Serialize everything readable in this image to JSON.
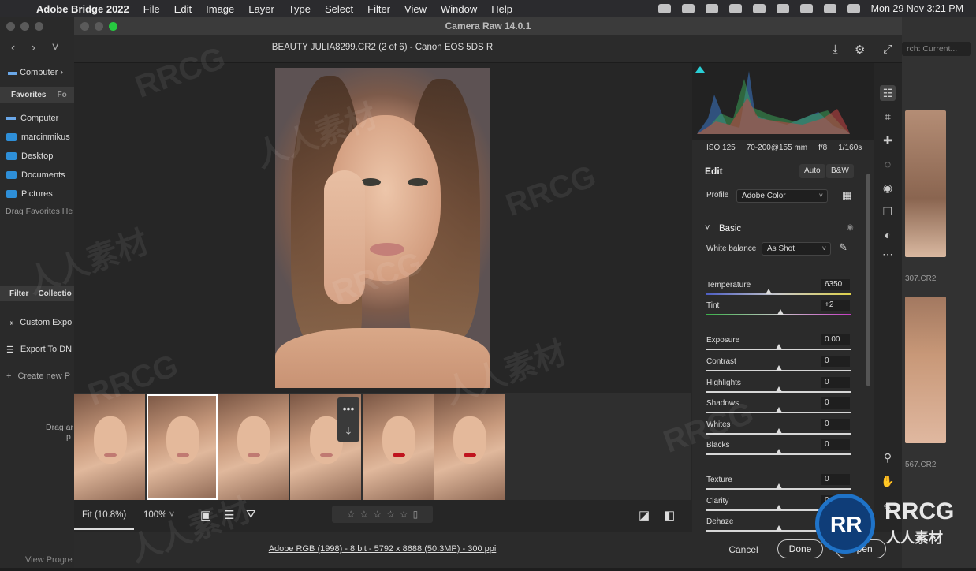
{
  "menubar": {
    "app_name": "Adobe Bridge 2022",
    "items": [
      "File",
      "Edit",
      "Image",
      "Layer",
      "Type",
      "Select",
      "Filter",
      "View",
      "Window",
      "Help"
    ],
    "clock": "Mon 29 Nov  3:21 PM"
  },
  "bridge": {
    "path_label": "Computer",
    "tab_favorites": "Favorites",
    "tab_folders": "Fo",
    "favorites": [
      "Computer",
      "marcinmikus",
      "Desktop",
      "Documents",
      "Pictures"
    ],
    "drag_hint": "Drag Favorites He",
    "filter_tab": "Filter",
    "collections_tab": "Collectio",
    "collections": [
      "Custom Expo",
      "Export To DN",
      "Create new P"
    ],
    "drag_hint2": "Drag ar",
    "drag_hint2b": "p",
    "view_progress": "View Progre",
    "search_placeholder": "rch: Current...",
    "thumb_captions": [
      "307.CR2",
      "567.CR2"
    ]
  },
  "camera_raw": {
    "window_title": "Camera Raw 14.0.1",
    "filename": "BEAUTY JULIA8299.CR2 (2 of 6)  -  Canon EOS 5DS R",
    "zoom_fit": "Fit (10.8%)",
    "zoom_level": "100%",
    "workflow": "Adobe RGB (1998) - 8 bit - 5792 x 8688 (50.3MP) - 300 ppi",
    "cancel": "Cancel",
    "done": "Done",
    "open": "Open",
    "thumb_menu": "•••",
    "filmstrip_lips": [
      "natural",
      "natural",
      "natural",
      "natural",
      "red",
      "red"
    ],
    "selected_index": 1
  },
  "panel": {
    "exif": [
      "ISO 125",
      "70-200@155 mm",
      "f/8",
      "1/160s"
    ],
    "edit_title": "Edit",
    "auto": "Auto",
    "bw": "B&W",
    "profile_label": "Profile",
    "profile_value": "Adobe Color",
    "basic_title": "Basic",
    "wb_label": "White balance",
    "wb_value": "As Shot",
    "sliders": [
      {
        "name": "Temperature",
        "value": "6350",
        "pos": 0.43,
        "track": "temp"
      },
      {
        "name": "Tint",
        "value": "+2",
        "pos": 0.51,
        "track": "tint"
      },
      {
        "name": "Exposure",
        "value": "0.00",
        "pos": 0.5,
        "track": "plain"
      },
      {
        "name": "Contrast",
        "value": "0",
        "pos": 0.5,
        "track": "plain"
      },
      {
        "name": "Highlights",
        "value": "0",
        "pos": 0.5,
        "track": "plain"
      },
      {
        "name": "Shadows",
        "value": "0",
        "pos": 0.5,
        "track": "plain"
      },
      {
        "name": "Whites",
        "value": "0",
        "pos": 0.5,
        "track": "plain"
      },
      {
        "name": "Blacks",
        "value": "0",
        "pos": 0.5,
        "track": "plain"
      },
      {
        "name": "Texture",
        "value": "0",
        "pos": 0.5,
        "track": "plain"
      },
      {
        "name": "Clarity",
        "value": "0",
        "pos": 0.5,
        "track": "plain"
      },
      {
        "name": "Dehaze",
        "value": "0",
        "pos": 0.5,
        "track": "plain"
      }
    ]
  },
  "watermark": {
    "text": "RRCG",
    "cn": "人人素材",
    "logo_letters": "RR"
  }
}
